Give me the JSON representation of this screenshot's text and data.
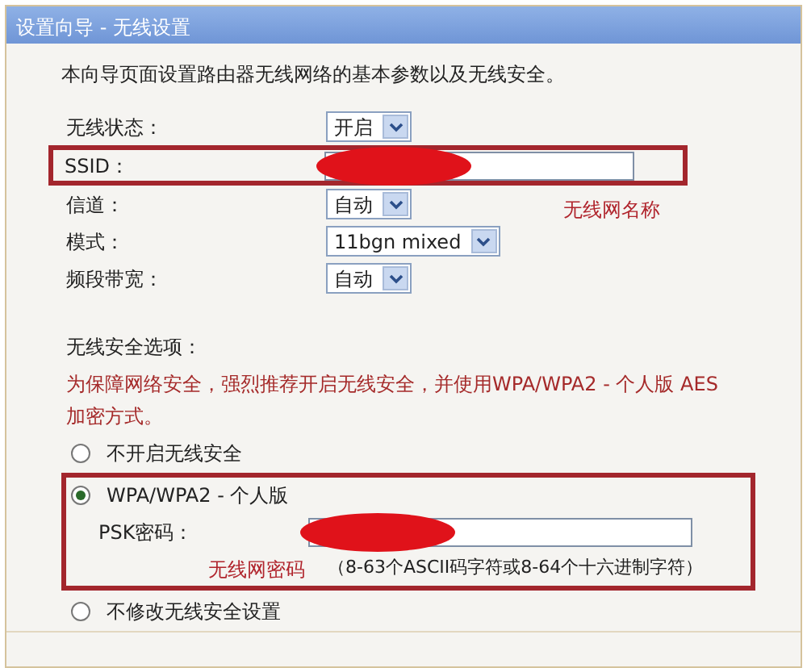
{
  "window": {
    "title": "设置向导 - 无线设置"
  },
  "intro": "本向导页面设置路由器无线网络的基本参数以及无线安全。",
  "fields": [
    {
      "label": "无线状态：",
      "kind": "select",
      "value": "开启"
    },
    {
      "label": "SSID：",
      "kind": "text",
      "redacted": true,
      "annotation": "无线网名称"
    },
    {
      "label": "信道：",
      "kind": "select",
      "value": "自动"
    },
    {
      "label": "模式：",
      "kind": "select",
      "value": "11bgn mixed"
    },
    {
      "label": "频段带宽：",
      "kind": "select",
      "value": "自动"
    }
  ],
  "security": {
    "heading": "无线安全选项：",
    "warning": "为保障网络安全，强烈推荐开启无线安全，并使用WPA/WPA2 - 个人版 AES加密方式。",
    "options": [
      {
        "label": "不开启无线安全",
        "selected": false
      },
      {
        "label": "WPA/WPA2 - 个人版",
        "selected": true,
        "annotation": "无线网密码",
        "psk": {
          "label": "PSK密码：",
          "redacted": true,
          "hint": "（8-63个ASCII码字符或8-64个十六进制字符）"
        }
      },
      {
        "label": "不修改无线安全设置",
        "selected": false
      }
    ]
  }
}
